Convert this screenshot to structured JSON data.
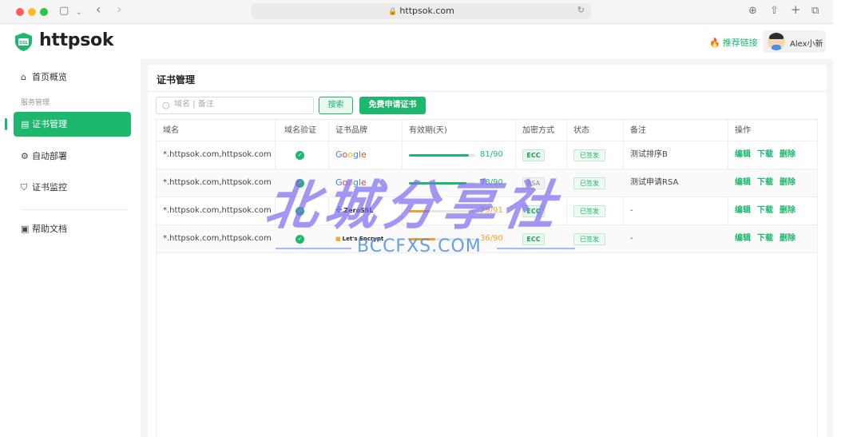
{
  "browser": {
    "url": "httpsok.com"
  },
  "header": {
    "logo_text": "httpsok",
    "logo_badge": "SSL",
    "recommend_label": "推荐链接",
    "user_name": "Alex小新"
  },
  "sidebar": {
    "group_label": "服务管理",
    "items": [
      {
        "label": "首页概览",
        "icon": "home-icon"
      },
      {
        "label": "证书管理",
        "icon": "certificate-icon"
      },
      {
        "label": "自动部署",
        "icon": "deploy-icon"
      },
      {
        "label": "证书监控",
        "icon": "shield-icon"
      },
      {
        "label": "帮助文档",
        "icon": "book-icon"
      }
    ]
  },
  "main": {
    "title": "证书管理",
    "search_placeholder": "域名 | 备注",
    "search_button": "搜索",
    "apply_button": "免费申请证书",
    "columns": [
      "域名",
      "域名验证",
      "证书品牌",
      "有效期(天)",
      "加密方式",
      "状态",
      "备注",
      "操作"
    ],
    "rows": [
      {
        "domain": "*.httpsok.com,httpsok.com",
        "verified": true,
        "brand": "Google",
        "validity": "81/90",
        "validity_ratio": 0.9,
        "encryption": "ECC",
        "status": "已签发",
        "note": "测试排序B"
      },
      {
        "domain": "*.httpsok.com,httpsok.com",
        "verified": true,
        "brand": "Google",
        "validity": "78/90",
        "validity_ratio": 0.867,
        "encryption": "RSA",
        "status": "已签发",
        "note": "测试申请RSA"
      },
      {
        "domain": "*.httpsok.com,httpsok.com",
        "verified": true,
        "brand": "ZeroSSL",
        "validity": "29/91",
        "validity_ratio": 0.319,
        "encryption": "ECC",
        "status": "已签发",
        "note": "-"
      },
      {
        "domain": "*.httpsok.com,httpsok.com",
        "verified": true,
        "brand": "Let's Encrypt",
        "validity": "36/90",
        "validity_ratio": 0.4,
        "encryption": "ECC",
        "status": "已签发",
        "note": "-"
      }
    ],
    "actions": {
      "edit": "编辑",
      "download": "下载",
      "delete": "删除"
    }
  },
  "watermark": {
    "main": "北城分享社",
    "sub": "BCCFXS.COM"
  },
  "colors": {
    "accent": "#1db86d",
    "progress_green": "#1db86d",
    "progress_orange": "#f0a030"
  }
}
